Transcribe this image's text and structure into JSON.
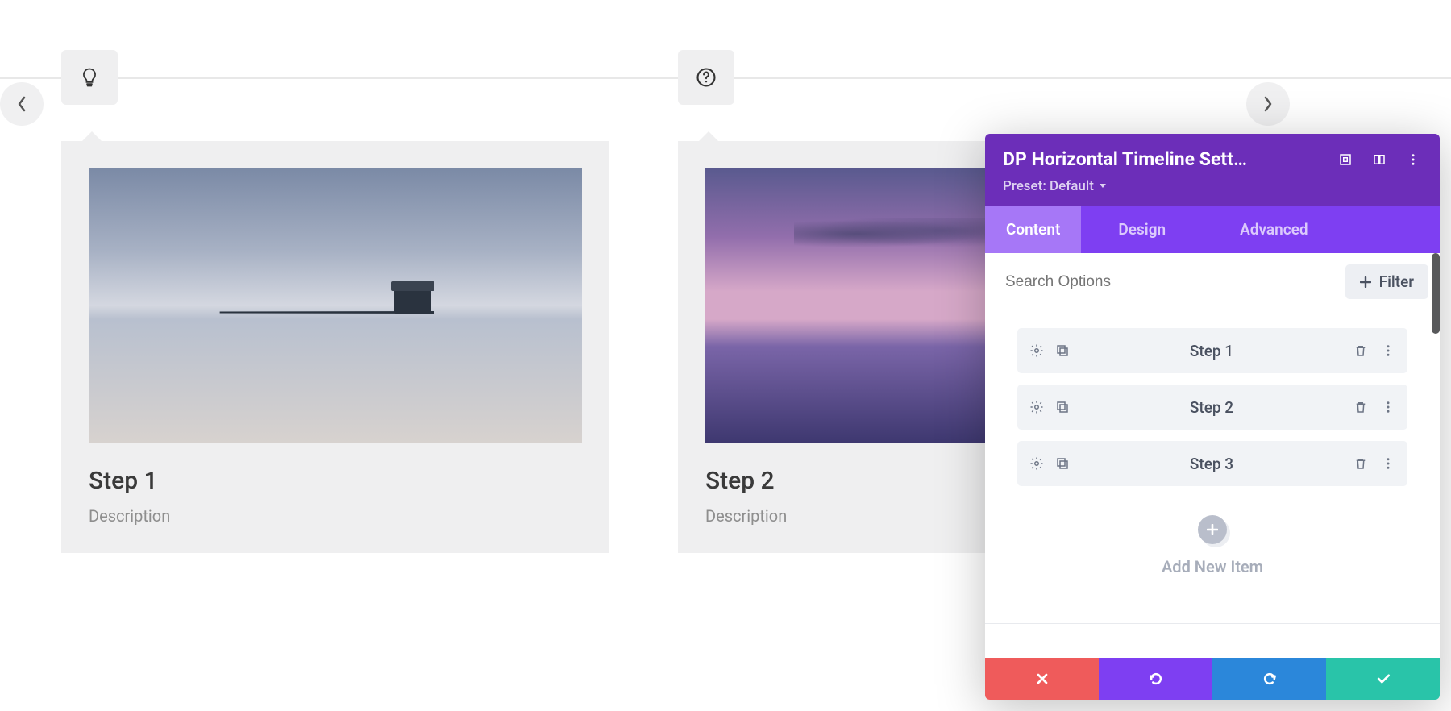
{
  "timeline": {
    "icons": [
      "lightbulb",
      "question"
    ],
    "cards": [
      {
        "title": "Step 1",
        "desc": "Description"
      },
      {
        "title": "Step 2",
        "desc": "Description"
      }
    ]
  },
  "panel": {
    "title": "DP Horizontal Timeline Sett…",
    "preset_label": "Preset: Default",
    "tabs": {
      "content": "Content",
      "design": "Design",
      "advanced": "Advanced",
      "active": "Content"
    },
    "search_placeholder": "Search Options",
    "filter_label": "Filter",
    "items": [
      {
        "label": "Step 1"
      },
      {
        "label": "Step 2"
      },
      {
        "label": "Step 3"
      }
    ],
    "add_label": "Add New Item"
  }
}
